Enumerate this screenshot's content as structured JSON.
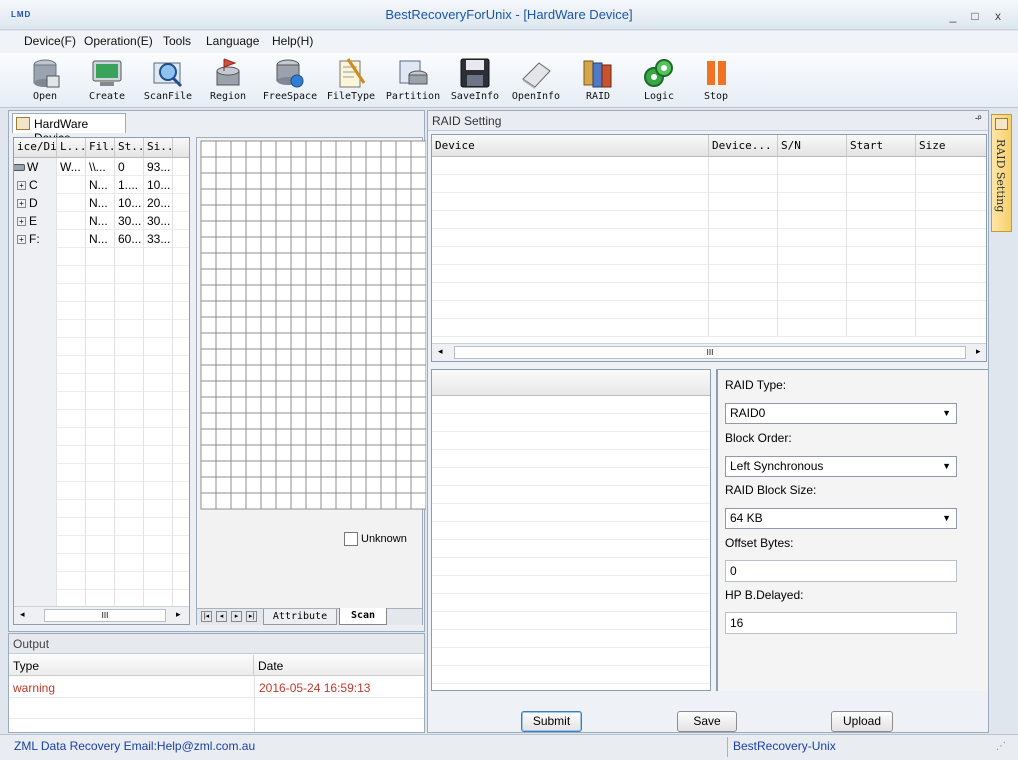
{
  "window": {
    "logo_text": "LMD",
    "title": "BestRecoveryForUnix - [HardWare Device]",
    "minimize": "_",
    "maximize": "□",
    "close": "x"
  },
  "menu": [
    "Device(F)",
    "Operation(E)",
    "Tools",
    "Language",
    "Help(H)"
  ],
  "toolbar": [
    {
      "label": "Open",
      "icon": "open-drive-icon"
    },
    {
      "label": "Create",
      "icon": "create-image-icon"
    },
    {
      "label": "ScanFile",
      "icon": "scan-file-icon"
    },
    {
      "label": "Region",
      "icon": "region-icon"
    },
    {
      "label": "FreeSpace",
      "icon": "free-space-icon"
    },
    {
      "label": "FileType",
      "icon": "file-type-icon"
    },
    {
      "label": "Partition",
      "icon": "partition-icon"
    },
    {
      "label": "SaveInfo",
      "icon": "save-info-icon"
    },
    {
      "label": "OpenInfo",
      "icon": "open-info-icon"
    },
    {
      "label": "RAID",
      "icon": "raid-icon"
    },
    {
      "label": "Logic",
      "icon": "logic-icon"
    },
    {
      "label": "Stop",
      "icon": "stop-icon"
    }
  ],
  "device_panel": {
    "tab_label": "HardWare Device",
    "columns": [
      "ice/Dis",
      "L...",
      "Fil...",
      "St...",
      "Si..."
    ],
    "rows": [
      [
        "W",
        "W...",
        "\\\\...",
        "0",
        "93..."
      ],
      [
        "C",
        "",
        "N...",
        "1....",
        "10..."
      ],
      [
        "D",
        "",
        "N...",
        "10...",
        "20..."
      ],
      [
        "E",
        "",
        "N...",
        "30...",
        "30..."
      ],
      [
        "F:",
        "",
        "N...",
        "60...",
        "33..."
      ]
    ],
    "hscroll_grip": "III"
  },
  "scan_panel": {
    "unknown_label": "Unknown",
    "unknown_checked": false,
    "tabs": [
      "Attribute",
      "Scan"
    ],
    "active_tab": "Scan"
  },
  "raid_panel": {
    "title": "RAID Setting",
    "pin": "-ᵖ",
    "columns": [
      "Device",
      "Device...",
      "S/N",
      "Start",
      "Size"
    ],
    "hscroll_grip": "III",
    "raid_type_label": "RAID Type:",
    "raid_type_value": "RAID0",
    "block_order_label": "Block Order:",
    "block_order_value": "Left Synchronous",
    "block_size_label": "RAID Block Size:",
    "block_size_value": "64 KB",
    "offset_label": "Offset Bytes:",
    "offset_value": "0",
    "hp_label": "HP B.Delayed:",
    "hp_value": "16",
    "submit": "Submit",
    "save": "Save",
    "upload": "Upload",
    "side_tab": "RAID Setting"
  },
  "output_panel": {
    "title": "Output",
    "columns": [
      "Type",
      "Date"
    ],
    "rows": [
      {
        "type": "warning",
        "date": "2016-05-24 16:59:13"
      }
    ]
  },
  "status": {
    "left": "ZML Data Recovery Email:Help@zml.com.au",
    "right": "BestRecovery-Unix"
  },
  "colors": {
    "accent": "#1b57a6",
    "warning": "#c0392b"
  }
}
